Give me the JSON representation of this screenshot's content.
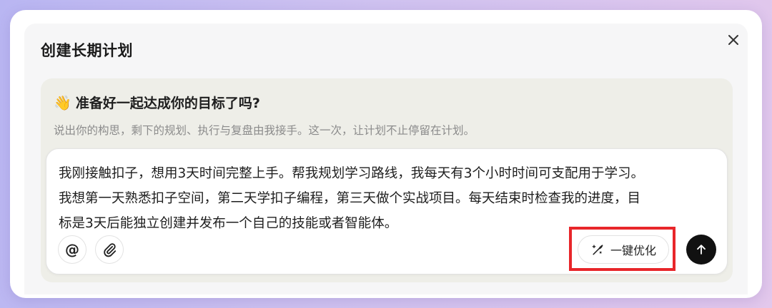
{
  "dialog": {
    "title": "创建长期计划",
    "greeting_emoji": "👋",
    "greeting": "准备好一起达成你的目标了吗?",
    "subtitle": "说出你的构思，剩下的规划、执行与复盘由我接手。这一次，让计划不止停留在计划。"
  },
  "input": {
    "lines": [
      "我刚接触扣子，想用3天时间完整上手。帮我规划学习路线，我每天有3个小时时间可支配用于学习。",
      "我想第一天熟悉扣子空间，第二天学扣子编程，第三天做个实战项目。每天结束时检查我的进度，目",
      "标是3天后能独立创建并发布一个自己的技能或者智能体。"
    ]
  },
  "toolbar": {
    "mention_label": "@",
    "optimize_label": "一键优化"
  },
  "icons": {
    "close": "close-icon",
    "mention": "at-icon",
    "attach": "paperclip-icon",
    "optimize": "magic-pen-icon",
    "send": "arrow-up-icon"
  },
  "colors": {
    "highlight": "#e8262a",
    "send_button": "#111111",
    "background_gradient": [
      "#b9b6f2",
      "#e3c8ec"
    ]
  }
}
